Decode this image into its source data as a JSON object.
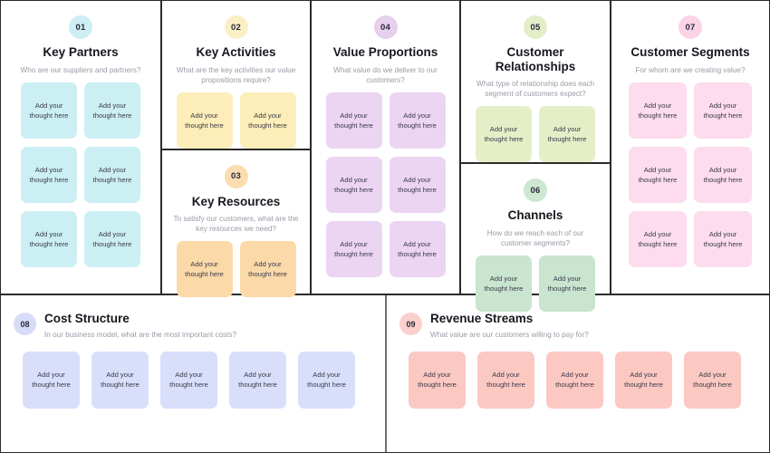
{
  "canvas": {
    "note_text": "Add your\nthought here",
    "border_color": "#2b2b2b"
  },
  "blocks": [
    {
      "number": "01",
      "title": "Key Partners",
      "subtitle": "Who are our suppliers and partners?",
      "badge_color": "#cdeef2",
      "note_color": "#cbeff3",
      "note_count": 6
    },
    {
      "number": "02",
      "title": "Key Activities",
      "subtitle": "What are the key activities our value propositions require?",
      "badge_color": "#fbf0c4",
      "note_color": "#fdedb8",
      "note_count": 2
    },
    {
      "number": "03",
      "title": "Key Resources",
      "subtitle": "To satisfy our customers, what are the key resources we need?",
      "badge_color": "#fbddb0",
      "note_color": "#fcd9a8",
      "note_count": 2
    },
    {
      "number": "04",
      "title": "Value Proportions",
      "subtitle": "What value do we deliver to our customers?",
      "badge_color": "#e7cfee",
      "note_color": "#ecd4f3",
      "note_count": 6
    },
    {
      "number": "05",
      "title": "Customer Relationships",
      "subtitle": "What type of relationship does each segment of customers expect?",
      "badge_color": "#e3eec9",
      "note_color": "#e4efc8",
      "note_count": 2
    },
    {
      "number": "06",
      "title": "Channels",
      "subtitle": "How do we reach each of our customer segments?",
      "badge_color": "#cde7d2",
      "note_color": "#c9e4cf",
      "note_count": 2
    },
    {
      "number": "07",
      "title": "Customer Segments",
      "subtitle": "For whom are we creating value?",
      "badge_color": "#fbd3e6",
      "note_color": "#fcdced",
      "note_count": 6
    }
  ],
  "bottom": [
    {
      "number": "08",
      "title": "Cost Structure",
      "subtitle": "In our business model, what are the most important costs?",
      "badge_color": "#d7dcf7",
      "note_color": "#d9dffa",
      "note_count": 5
    },
    {
      "number": "09",
      "title": "Revenue Streams",
      "subtitle": "What value are our customers willing to pay for?",
      "badge_color": "#fbd0cc",
      "note_color": "#fcc8c2",
      "note_count": 5
    }
  ]
}
